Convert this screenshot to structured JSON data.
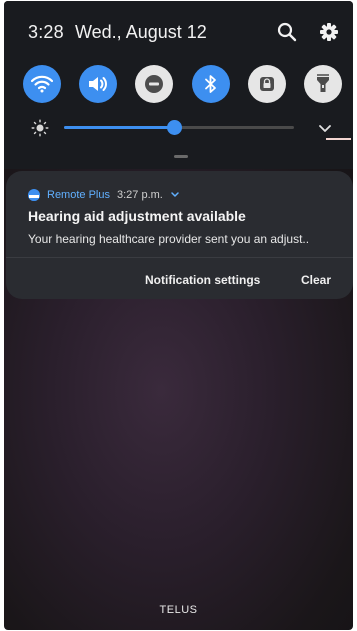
{
  "status_bar": {
    "time": "3:28",
    "date": "Wed., August 12",
    "icons": [
      "search-icon",
      "settings-gear-icon"
    ]
  },
  "quick_settings": {
    "tiles": [
      {
        "name": "wifi",
        "icon": "wifi-icon",
        "state": "on"
      },
      {
        "name": "sound",
        "icon": "volume-icon",
        "state": "on"
      },
      {
        "name": "do-not-disturb",
        "icon": "do-not-disturb-icon",
        "state": "off"
      },
      {
        "name": "bluetooth",
        "icon": "bluetooth-icon",
        "state": "on"
      },
      {
        "name": "screen-lock",
        "icon": "lock-icon",
        "state": "off"
      },
      {
        "name": "flashlight",
        "icon": "flashlight-icon",
        "state": "off"
      }
    ],
    "brightness_level": 0.48,
    "expand_icon": "chevron-down-icon",
    "accent_color": "#3d8ff0"
  },
  "notification": {
    "app_name": "Remote Plus",
    "time": "3:27 p.m.",
    "title": "Hearing aid adjustment available",
    "body": "Your hearing healthcare provider sent you an adjust..",
    "actions": {
      "settings_label": "Notification settings",
      "clear_label": "Clear"
    }
  },
  "carrier": "TELUS"
}
